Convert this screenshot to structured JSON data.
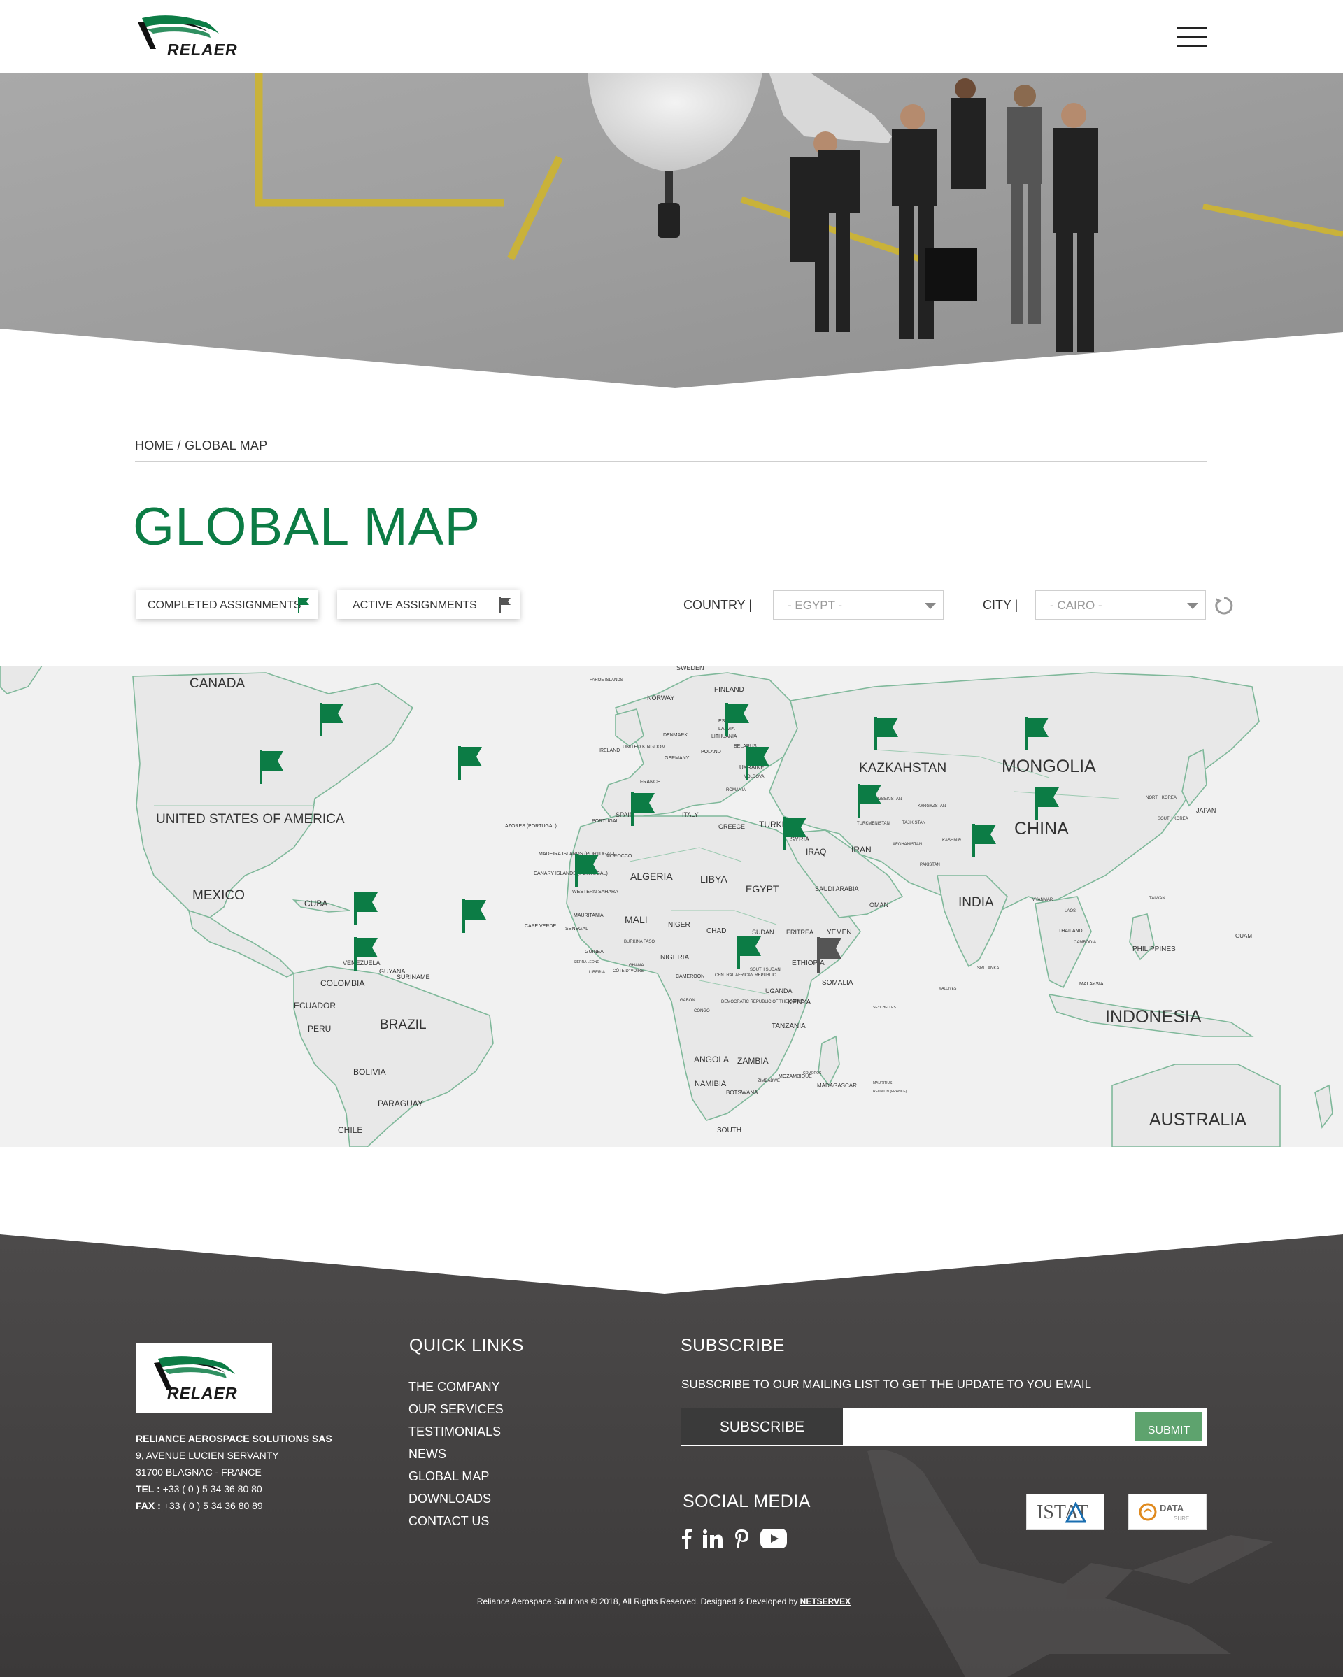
{
  "header": {
    "logo_text": "RELAER",
    "menu_icon": "hamburger-menu-icon"
  },
  "breadcrumb": {
    "home": "HOME",
    "separator": " / ",
    "current": "GLOBAL MAP"
  },
  "page": {
    "title": "GLOBAL MAP"
  },
  "filters": {
    "completed_label": "COMPLETED ASSIGNMENTS",
    "active_label": "ACTIVE ASSIGNMENTS",
    "completed_color": "#0c7c45",
    "active_color": "#555555",
    "country_label": "COUNTRY  |",
    "country_value": "-  EGYPT  -",
    "city_label": "CITY  |",
    "city_value": "- CAIRO  -",
    "reset_icon": "refresh-icon"
  },
  "map": {
    "labels_large": [
      "CANADA",
      "UNITED STATES OF AMERICA",
      "MEXICO",
      "BRAZIL",
      "KAZKAHSTAN",
      "MONGOLIA",
      "CHINA",
      "INDIA",
      "INDONESIA",
      "AUSTRALIA"
    ],
    "labels_medium": [
      "CUBA",
      "COLOMBIA",
      "ECUADOR",
      "PERU",
      "BOLIVIA",
      "PARAGUAY",
      "CHILE",
      "VENEZUELA",
      "GUYANA",
      "SURINAME",
      "ALGERIA",
      "LIBYA",
      "EGYPT",
      "MALI",
      "NIGER",
      "CHAD",
      "SUDAN",
      "NIGERIA",
      "ETHIOPIA",
      "SOMALIA",
      "KENYA",
      "TANZANIA",
      "ANGOLA",
      "ZAMBIA",
      "NAMIBIA",
      "BOTSWANA",
      "SOUTH",
      "MOZAMBIQUE",
      "MADAGASCAR",
      "SAUDI ARABIA",
      "YEMEN",
      "OMAN",
      "ERITREA",
      "IRAN",
      "IRAQ",
      "SYRIA",
      "TURKEY",
      "GREECE",
      "ITALY",
      "SPAIN",
      "PORTUGAL",
      "FRANCE",
      "GERMANY",
      "UNITED KINGDOM",
      "IRELAND",
      "POLAND",
      "UKRAINE",
      "BELARUS",
      "LITHUANIA",
      "LATVIA",
      "ESTONIA",
      "FINLAND",
      "SWEDEN",
      "NORWAY",
      "DENMARK",
      "ROMANIA",
      "MOLDOVA",
      "MOROCCO",
      "WESTERN SAHARA",
      "MAURITANIA",
      "SENEGAL",
      "GUINEA",
      "UGANDA",
      "CAMEROON",
      "GABON",
      "CONGO",
      "SOUTH SUDAN",
      "THAILAND",
      "MALAYSIA",
      "PHILIPPINES",
      "JAPAN",
      "SOUTH KOREA",
      "NORTH KOREA",
      "TAIWAN",
      "LAOS",
      "CAMBODIA",
      "MYANMAR",
      "PAKISTAN",
      "AFGHANISTAN",
      "TURKMENISTAN",
      "UZBEKISTAN",
      "KYRGYZSTAN",
      "TAJIKISTAN",
      "SRI LANKA",
      "GUAM",
      "AZORES (PORTUGAL)",
      "MADEIRA ISLANDS (PORTUGAL)",
      "CANARY ISLANDS (PORTUGAL)",
      "CAPE VERDE",
      "FAROE ISLANDS",
      "BURKINA FASO",
      "CÔTE D'IVOIRE",
      "GHANA",
      "LIBERIA",
      "SIERRA LEONE",
      "CENTRAL AFRICAN REPUBLIC",
      "DEMOCRATIC REPUBLIC OF THE CONGO",
      "ZIMBABWE",
      "COMOROS",
      "MAURITIUS",
      "REUNION (FRANCE)",
      "SEYCHELLES",
      "MALDIVES",
      "KASHMIR"
    ],
    "flag_completed_icon": "green-flag-icon",
    "flag_active_icon": "grey-flag-icon"
  },
  "footer": {
    "logo_text": "RELAER",
    "address": {
      "company": "RELIANCE AEROSPACE SOLUTIONS SAS",
      "street": "9, AVENUE LUCIEN SERVANTY",
      "city": "31700 BLAGNAC - FRANCE",
      "tel_label": "TEL :",
      "tel": " +33 ( 0 ) 5 34 36 80 80",
      "fax_label": "FAX :",
      "fax": " +33 ( 0 ) 5 34 36 80 89"
    },
    "quick_links": {
      "heading": "QUICK LINKS",
      "items": [
        "THE COMPANY",
        "OUR SERVICES",
        "TESTIMONIALS",
        "NEWS",
        "GLOBAL MAP",
        "DOWNLOADS",
        "CONTACT US"
      ]
    },
    "subscribe": {
      "heading": "SUBSCRIBE",
      "description": "SUBSCRIBE TO OUR MAILING LIST TO GET THE UPDATE TO YOU EMAIL",
      "label": "SUBSCRIBE",
      "input_placeholder": "",
      "button": "SUBMIT"
    },
    "social": {
      "heading": "SOCIAL MEDIA",
      "icons": [
        "facebook-icon",
        "linkedin-icon",
        "pinterest-icon",
        "youtube-icon"
      ]
    },
    "partners": {
      "istat": "ISTAT",
      "datasure_line1": "DATA",
      "datasure_line2": "SURE"
    },
    "copyright": "Reliance Aerospace Solutions © 2018, All Rights Reserved. Designed & Developed by ",
    "developer": "NETSERVEX"
  },
  "colors": {
    "brand_green": "#0c7c45",
    "footer_bg": "#4a4848",
    "submit_green": "#5ea36e",
    "map_land": "#e8e8e8",
    "map_border": "#7fb89a"
  }
}
